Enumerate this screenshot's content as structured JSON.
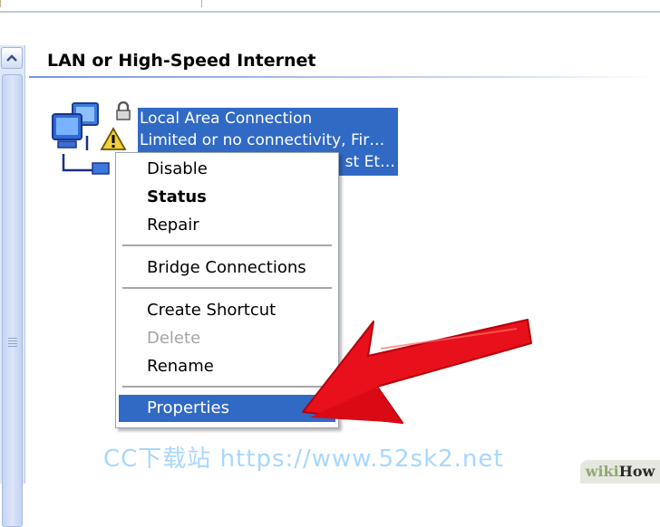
{
  "group": {
    "header": "LAN or High-Speed Internet"
  },
  "connection": {
    "name": "Local Area Connection",
    "status": "Limited or no connectivity, Fir…",
    "device": "st Et…"
  },
  "context_menu": {
    "items": [
      {
        "label": "Disable",
        "style": "normal"
      },
      {
        "label": "Status",
        "style": "bold"
      },
      {
        "label": "Repair",
        "style": "normal"
      },
      {
        "label": "Bridge Connections",
        "style": "normal"
      },
      {
        "label": "Create Shortcut",
        "style": "normal"
      },
      {
        "label": "Delete",
        "style": "disabled"
      },
      {
        "label": "Rename",
        "style": "normal"
      },
      {
        "label": "Properties",
        "style": "selected"
      }
    ]
  },
  "watermark": "CC下载站 https://www.52sk2.net",
  "badge": {
    "part1": "wiki",
    "part2": "How"
  },
  "colors": {
    "selection": "#316ac5",
    "arrow": "#e8101a",
    "header_rule": "#7396d7"
  },
  "icons": [
    "scroll-up-arrow-icon",
    "network-connection-icon",
    "lock-icon",
    "warning-icon",
    "red-arrow-icon"
  ]
}
